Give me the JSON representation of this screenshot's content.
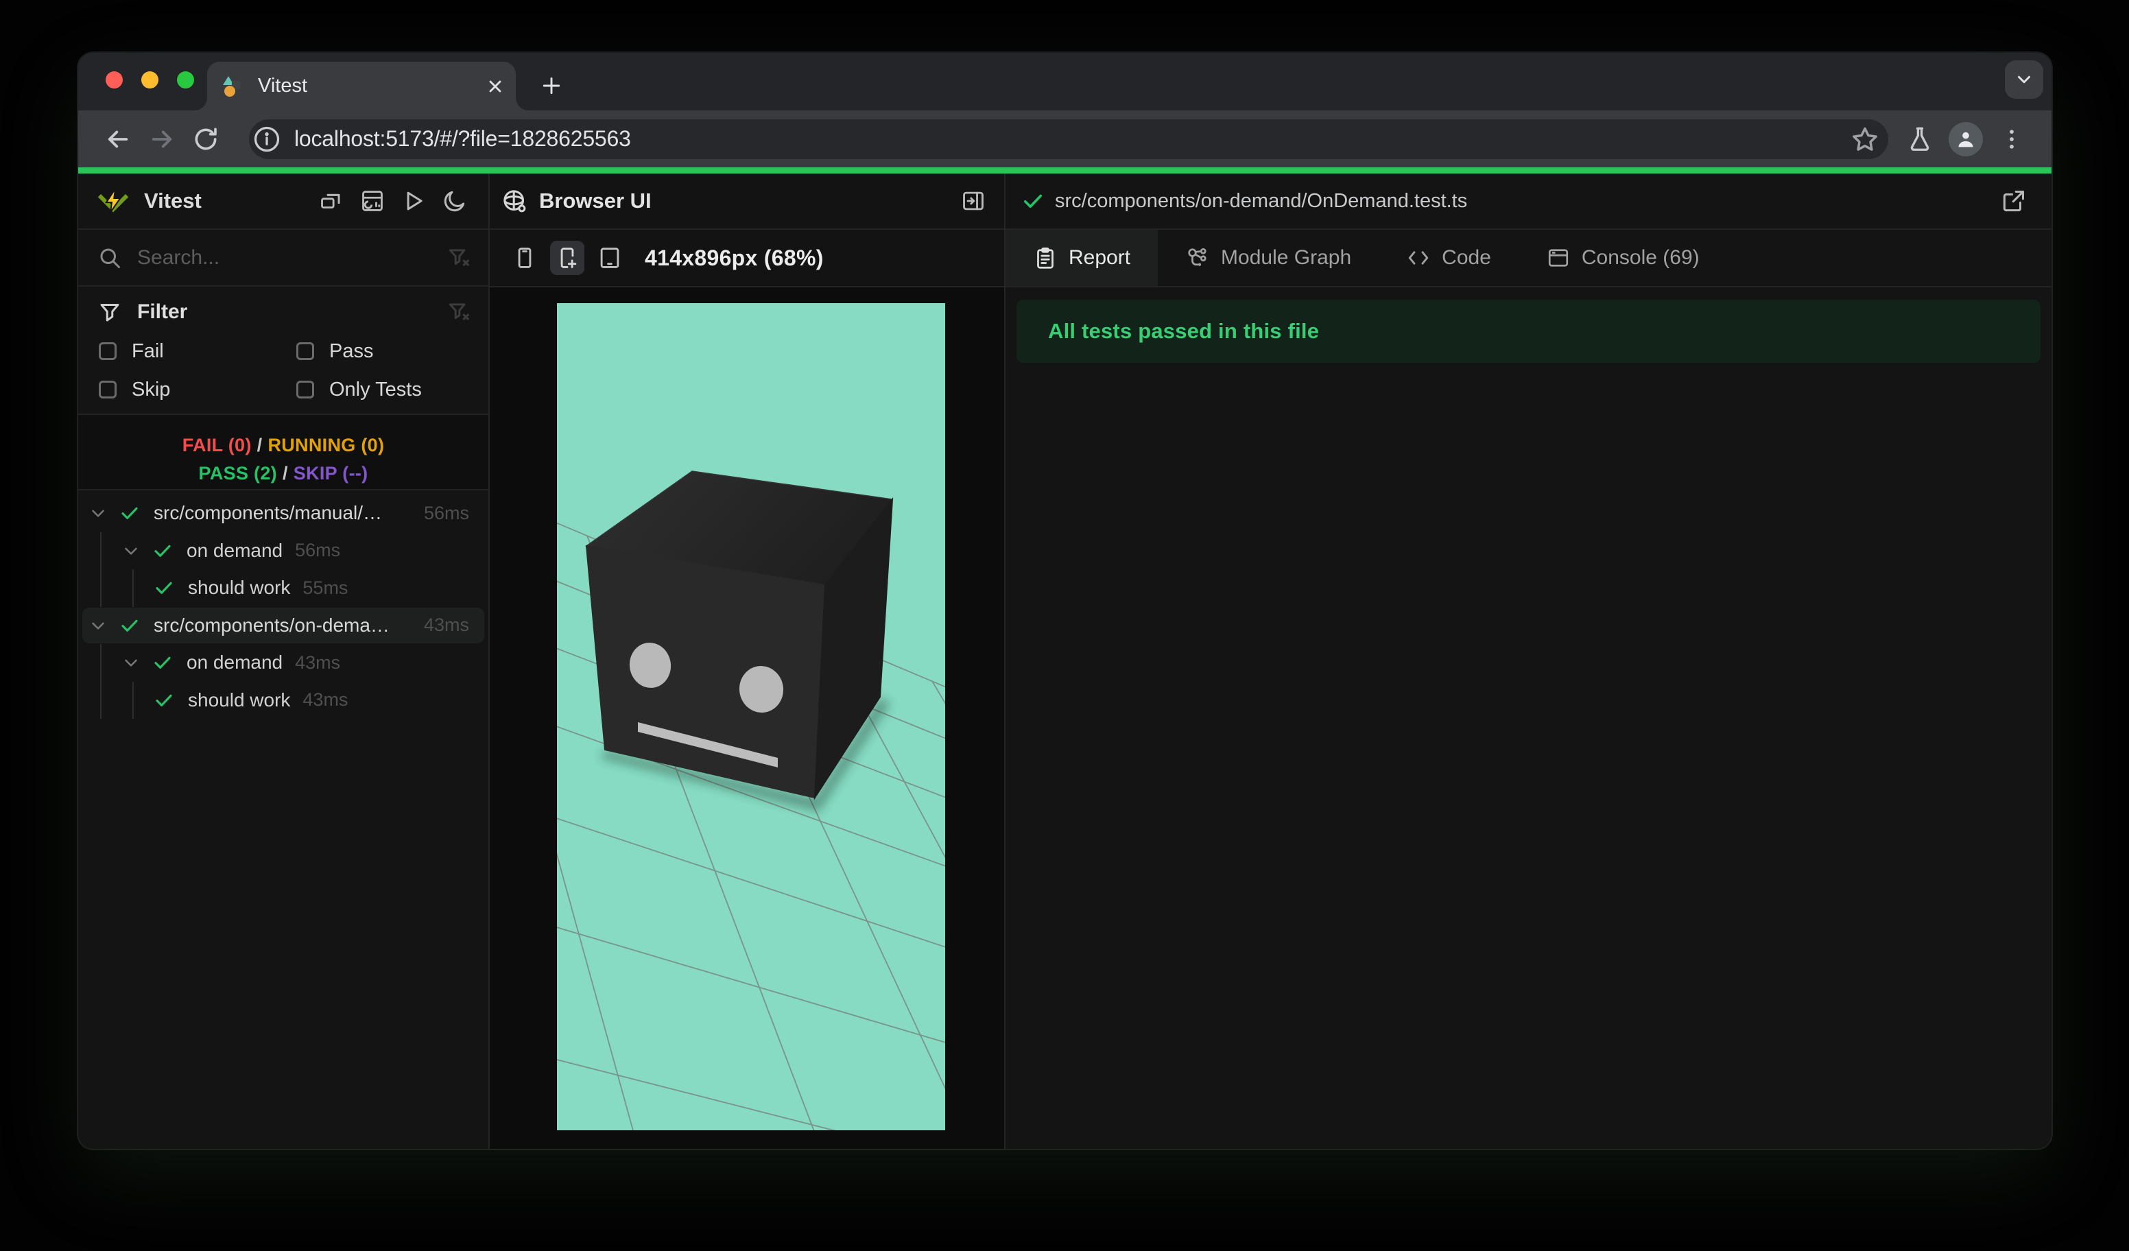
{
  "browser": {
    "tab_title": "Vitest",
    "url": "localhost:5173/#/?file=1828625563"
  },
  "sidebar": {
    "app_title": "Vitest",
    "search_placeholder": "Search...",
    "filter": {
      "title": "Filter",
      "options": [
        {
          "label": "Fail"
        },
        {
          "label": "Pass"
        },
        {
          "label": "Skip"
        },
        {
          "label": "Only Tests"
        }
      ]
    },
    "summary": {
      "fail": "FAIL (0)",
      "running": "RUNNING (0)",
      "pass": "PASS (2)",
      "skip": "SKIP (--)",
      "sep": "/"
    },
    "tree": [
      {
        "name": "src/components/manual/…",
        "duration": "56ms"
      },
      {
        "name": "on demand",
        "duration": "56ms"
      },
      {
        "name": "should work",
        "duration": "55ms"
      },
      {
        "name": "src/components/on-dema…",
        "duration": "43ms"
      },
      {
        "name": "on demand",
        "duration": "43ms"
      },
      {
        "name": "should work",
        "duration": "43ms"
      }
    ]
  },
  "preview": {
    "title": "Browser UI",
    "viewport": "414x896px (68%)"
  },
  "report": {
    "file_path": "src/components/on-demand/OnDemand.test.ts",
    "tabs": [
      "Report",
      "Module Graph",
      "Code",
      "Console (69)"
    ],
    "banner": "All tests passed in this file"
  },
  "colors": {
    "accent_green": "#2bc456",
    "pass_green": "#27c268",
    "fail_red": "#f34d4d",
    "running_yellow": "#e0a208",
    "skip_purple": "#8456cc",
    "banner_text_green": "#38cf74",
    "banner_bg_green": "#12231a",
    "preview_teal": "#86dbc2",
    "grid_line_gray": "#7a948b",
    "selected_row_bg": "#1e1f1f",
    "traffic_red": "#ff5f57",
    "traffic_yellow": "#febc2e",
    "traffic_green": "#28c840"
  }
}
